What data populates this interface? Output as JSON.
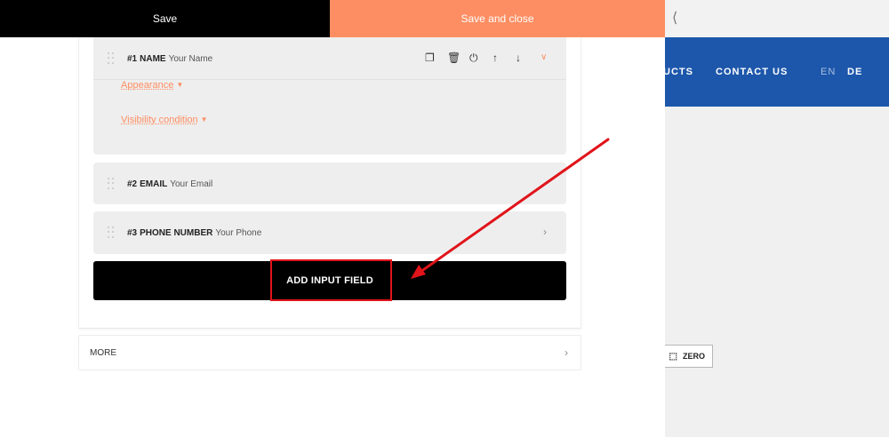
{
  "topbar": {
    "save_label": "Save",
    "save_close_label": "Save and close",
    "collapse_icon": "chevron-left-icon"
  },
  "preview": {
    "nav": {
      "products_label": "UCTS",
      "contact_label": "CONTACT US",
      "lang_en": "EN",
      "lang_de": "DE"
    },
    "zero_label": "ZERO",
    "nav_color": "#1d57ab"
  },
  "fields": [
    {
      "number": "#1",
      "type": "NAME",
      "placeholder": "Your Name"
    },
    {
      "number": "#2",
      "type": "EMAIL",
      "placeholder": "Your Email"
    },
    {
      "number": "#3",
      "type": "PHONE NUMBER",
      "placeholder": "Your Phone"
    }
  ],
  "expanded_field": {
    "appearance_label": "Appearance",
    "visibility_label": "Visibility condition",
    "tools": [
      "copy-icon",
      "trash-icon",
      "power-icon",
      "arrow-up-icon",
      "arrow-down-icon",
      "chevron-down-icon"
    ]
  },
  "add_button_label": "ADD INPUT FIELD",
  "more_label": "MORE",
  "colors": {
    "accent": "#fd8e63",
    "annotation": "#e0141a"
  }
}
